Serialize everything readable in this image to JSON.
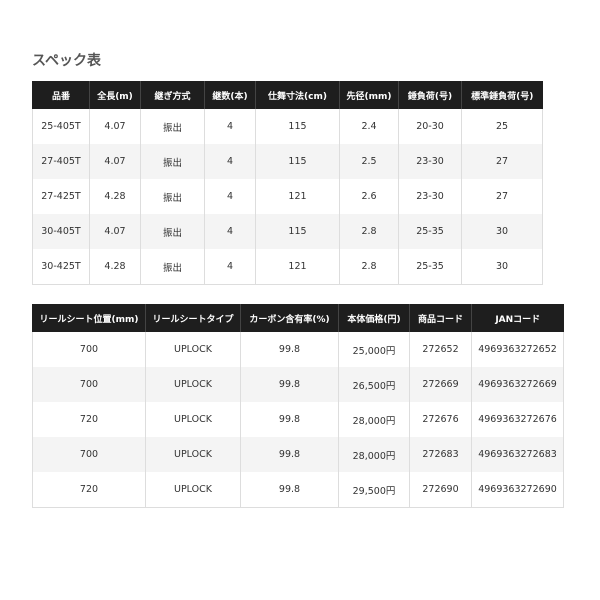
{
  "title": "スペック表",
  "table1": {
    "headers": [
      "品番",
      "全長(m)",
      "継ぎ方式",
      "継数(本)",
      "仕舞寸法(cm)",
      "先径(mm)",
      "錘負荷(号)",
      "標準錘負荷(号)"
    ],
    "rows": [
      [
        "25-405T",
        "4.07",
        "振出",
        "4",
        "115",
        "2.4",
        "20-30",
        "25"
      ],
      [
        "27-405T",
        "4.07",
        "振出",
        "4",
        "115",
        "2.5",
        "23-30",
        "27"
      ],
      [
        "27-425T",
        "4.28",
        "振出",
        "4",
        "121",
        "2.6",
        "23-30",
        "27"
      ],
      [
        "30-405T",
        "4.07",
        "振出",
        "4",
        "115",
        "2.8",
        "25-35",
        "30"
      ],
      [
        "30-425T",
        "4.28",
        "振出",
        "4",
        "121",
        "2.8",
        "25-35",
        "30"
      ]
    ]
  },
  "table2": {
    "headers": [
      "リールシート位置(mm)",
      "リールシートタイプ",
      "カーボン含有率(%)",
      "本体価格(円)",
      "商品コード",
      "JANコード"
    ],
    "rows": [
      [
        "700",
        "UPLOCK",
        "99.8",
        "25,000円",
        "272652",
        "4969363272652"
      ],
      [
        "700",
        "UPLOCK",
        "99.8",
        "26,500円",
        "272669",
        "4969363272669"
      ],
      [
        "720",
        "UPLOCK",
        "99.8",
        "28,000円",
        "272676",
        "4969363272676"
      ],
      [
        "700",
        "UPLOCK",
        "99.8",
        "28,000円",
        "272683",
        "4969363272683"
      ],
      [
        "720",
        "UPLOCK",
        "99.8",
        "29,500円",
        "272690",
        "4969363272690"
      ]
    ]
  }
}
